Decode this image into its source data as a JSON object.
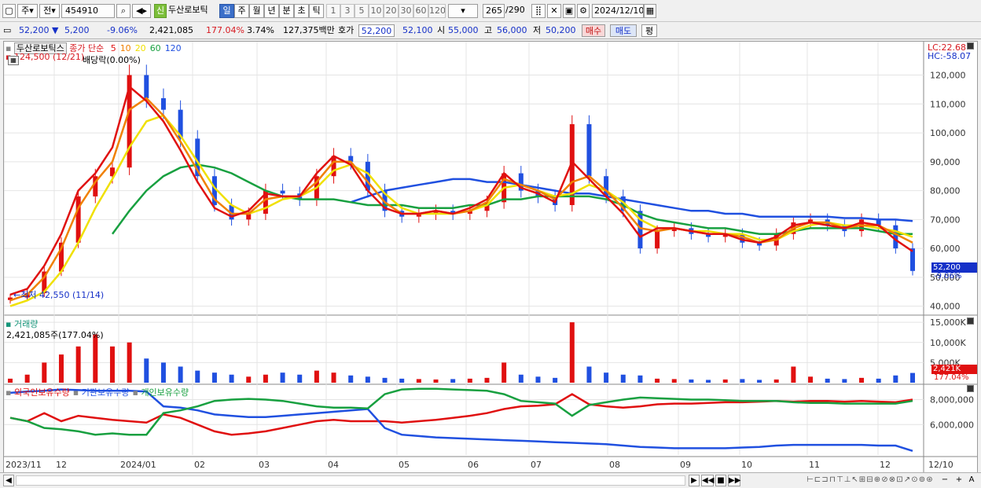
{
  "toolbar": {
    "market": "주",
    "type": "전",
    "code": "454910",
    "new_badge": "신",
    "stock_name": "두산로보틱",
    "periods": [
      "일",
      "주",
      "월",
      "년",
      "분",
      "초",
      "틱"
    ],
    "active_period": "일",
    "intervals": [
      "1",
      "3",
      "5",
      "10",
      "20",
      "30",
      "60",
      "120"
    ],
    "count": "265",
    "total": "/290",
    "date": "2024/12/10"
  },
  "info": {
    "price": "52,200",
    "change_arrow": "▼",
    "change": "5,200",
    "change_pct": "-9.06%",
    "volume": "2,421,085",
    "volume_ratio": "177.04%",
    "turnover": "3.74%",
    "amount": "127,375백만",
    "ask_label": "호가",
    "ask": "52,200",
    "bid": "52,100",
    "open_label": "시",
    "open": "55,000",
    "high_label": "고",
    "high": "56,000",
    "low_label": "저",
    "low": "50,200",
    "buy_btn": "매수",
    "sell_btn": "매도",
    "eval_btn": "평"
  },
  "chart": {
    "legend_name": "두산로보틱스",
    "legend_ma_prefix": "종가 단순",
    "ma_periods": [
      {
        "label": "5",
        "color": "#e01010"
      },
      {
        "label": "10",
        "color": "#f08000"
      },
      {
        "label": "20",
        "color": "#f0e000"
      },
      {
        "label": "60",
        "color": "#18a040"
      },
      {
        "label": "120",
        "color": "#2050e0"
      }
    ],
    "high_note": "124,500 (12/21)",
    "dividend_note": "배당락(0.00%)",
    "low_note": "최저 42,550 (11/14)",
    "lc": "LC:22.68",
    "hc": "HC:-58.07",
    "current_tag": "52,200",
    "current_pct": "-9.06%",
    "volume_title": "거래량",
    "volume_note": "2,421,085주(177.04%)",
    "volume_tag": "2,421K",
    "volume_pct": "177.04%",
    "holders_legend": [
      "외국인보유수량",
      "기관보유수량",
      "개인보유수량"
    ],
    "holders_colors": [
      "#e01010",
      "#2050e0",
      "#18a040"
    ],
    "x_labels": [
      "2023/11",
      "12",
      "2024/01",
      "02",
      "03",
      "04",
      "05",
      "06",
      "07",
      "08",
      "09",
      "10",
      "11",
      "12",
      "12/10"
    ]
  },
  "chart_data": [
    {
      "type": "line",
      "title": "",
      "series_note": "candlestick with moving averages",
      "ylim": [
        40000,
        124500
      ],
      "y_ticks": [
        40000,
        50000,
        60000,
        70000,
        80000,
        90000,
        100000,
        110000,
        120000
      ],
      "y_tick_labels": [
        "40,000",
        "50,000",
        "60,000",
        "70,000",
        "80,000",
        "90,000",
        "100,000",
        "110,000",
        "120,000"
      ],
      "x_months": [
        "2023/11",
        "12",
        "2024/01",
        "02",
        "03",
        "04",
        "05",
        "06",
        "07",
        "08",
        "09",
        "10",
        "11",
        "12"
      ],
      "close": [
        43000,
        44500,
        52000,
        62000,
        78000,
        85000,
        88000,
        120000,
        112000,
        108000,
        98000,
        85000,
        75000,
        70000,
        72000,
        80000,
        79000,
        77000,
        85000,
        92000,
        90000,
        80000,
        73000,
        71000,
        72000,
        73000,
        72000,
        73000,
        76000,
        86000,
        80000,
        78000,
        75000,
        103000,
        85000,
        78000,
        73000,
        60000,
        66000,
        67000,
        65000,
        64000,
        65000,
        62000,
        61000,
        65000,
        69000,
        70000,
        68000,
        66000,
        70000,
        68000,
        60000,
        52200
      ],
      "ma5": [
        44000,
        46000,
        54000,
        65000,
        80000,
        86000,
        95000,
        116000,
        111000,
        104000,
        94000,
        83000,
        74000,
        71000,
        73000,
        79000,
        78000,
        78000,
        86000,
        92000,
        89000,
        80000,
        74000,
        72000,
        72000,
        73000,
        72000,
        74000,
        77000,
        86000,
        81000,
        79000,
        76000,
        90000,
        84000,
        78000,
        72000,
        64000,
        67000,
        67000,
        66000,
        65000,
        65000,
        63000,
        62000,
        64000,
        68000,
        69000,
        68000,
        67000,
        69000,
        68000,
        63000,
        59000
      ],
      "ma10": [
        42000,
        44000,
        50000,
        60000,
        74000,
        83000,
        90000,
        108000,
        112000,
        106000,
        97000,
        87000,
        77000,
        72000,
        72000,
        77000,
        78000,
        78000,
        83000,
        90000,
        90000,
        83000,
        76000,
        72000,
        72000,
        73000,
        72000,
        73000,
        76000,
        84000,
        82000,
        80000,
        77000,
        83000,
        85000,
        80000,
        74000,
        67000,
        66000,
        67000,
        66000,
        65000,
        65000,
        64000,
        62000,
        63000,
        67000,
        69000,
        69000,
        67000,
        68000,
        68000,
        65000,
        62000
      ],
      "ma20": [
        40000,
        42000,
        45000,
        52000,
        62000,
        74000,
        84000,
        95000,
        104000,
        106000,
        99000,
        90000,
        81000,
        75000,
        72000,
        74000,
        77000,
        78000,
        81000,
        87000,
        89000,
        86000,
        79000,
        74000,
        72000,
        72000,
        72000,
        73000,
        75000,
        81000,
        82000,
        80000,
        78000,
        79000,
        82000,
        80000,
        76000,
        70000,
        67000,
        67000,
        66000,
        66000,
        65000,
        65000,
        63000,
        63000,
        66000,
        68000,
        69000,
        68000,
        68000,
        67000,
        66000,
        64000
      ],
      "ma60": [
        null,
        null,
        null,
        null,
        null,
        null,
        65000,
        73000,
        80000,
        85000,
        88000,
        89000,
        88000,
        86000,
        83000,
        80000,
        78000,
        77000,
        77000,
        77000,
        76000,
        75000,
        75000,
        75000,
        74000,
        74000,
        74000,
        75000,
        75000,
        77000,
        77000,
        78000,
        78000,
        78000,
        78000,
        77000,
        75000,
        72000,
        70000,
        69000,
        68000,
        67000,
        67000,
        66000,
        65000,
        65000,
        66000,
        67000,
        67000,
        67000,
        67000,
        66000,
        65000,
        65000
      ],
      "ma120": [
        null,
        null,
        null,
        null,
        null,
        null,
        null,
        null,
        null,
        null,
        null,
        null,
        null,
        null,
        null,
        null,
        null,
        null,
        null,
        null,
        76000,
        78000,
        80000,
        81000,
        82000,
        83000,
        84000,
        84000,
        83000,
        83000,
        82000,
        81000,
        80000,
        79000,
        79000,
        78000,
        77000,
        76000,
        75000,
        74000,
        73000,
        73000,
        72000,
        72000,
        71000,
        71000,
        71000,
        71000,
        71000,
        70500,
        70500,
        70000,
        70000,
        69500
      ]
    },
    {
      "type": "bar",
      "title": "거래량",
      "y_tick_labels": [
        "5,000K",
        "10,000K",
        "15,000K"
      ],
      "ylim": [
        0,
        16000000
      ],
      "values": [
        1000000,
        2000000,
        5000000,
        7000000,
        9000000,
        12000000,
        9000000,
        10000000,
        6000000,
        5000000,
        4000000,
        3000000,
        2500000,
        2000000,
        1500000,
        2000000,
        2500000,
        2000000,
        3000000,
        2500000,
        1800000,
        1500000,
        1200000,
        1000000,
        900000,
        800000,
        900000,
        1000000,
        1200000,
        5000000,
        2000000,
        1500000,
        1200000,
        15000000,
        4000000,
        2500000,
        2000000,
        1800000,
        1000000,
        900000,
        800000,
        700000,
        800000,
        900000,
        700000,
        800000,
        4000000,
        1500000,
        1000000,
        900000,
        1200000,
        1000000,
        1800000,
        2421085
      ]
    },
    {
      "type": "line",
      "title": "보유수량",
      "y_tick_labels": [
        "6,000,000",
        "8,000,000"
      ],
      "series": [
        {
          "name": "외국인보유수량",
          "values": [
            0.55,
            0.5,
            0.62,
            0.5,
            0.58,
            0.55,
            0.52,
            0.5,
            0.48,
            0.6,
            0.55,
            0.45,
            0.35,
            0.3,
            0.32,
            0.35,
            0.4,
            0.45,
            0.5,
            0.52,
            0.5,
            0.5,
            0.5,
            0.48,
            0.5,
            0.52,
            0.55,
            0.58,
            0.62,
            0.68,
            0.72,
            0.73,
            0.75,
            0.9,
            0.75,
            0.72,
            0.7,
            0.72,
            0.75,
            0.76,
            0.76,
            0.77,
            0.78,
            0.78,
            0.79,
            0.8,
            0.79,
            0.8,
            0.8,
            0.79,
            0.8,
            0.79,
            0.78,
            0.82
          ]
        },
        {
          "name": "기관보유수량",
          "values": [
            0.92,
            0.94,
            0.95,
            0.97,
            0.96,
            0.95,
            0.95,
            0.95,
            0.94,
            0.72,
            0.7,
            0.66,
            0.6,
            0.58,
            0.56,
            0.56,
            0.58,
            0.6,
            0.62,
            0.64,
            0.66,
            0.68,
            0.4,
            0.3,
            0.28,
            0.26,
            0.25,
            0.24,
            0.23,
            0.22,
            0.21,
            0.2,
            0.19,
            0.18,
            0.17,
            0.16,
            0.14,
            0.12,
            0.11,
            0.1,
            0.1,
            0.1,
            0.1,
            0.11,
            0.12,
            0.14,
            0.15,
            0.15,
            0.15,
            0.15,
            0.15,
            0.14,
            0.14,
            0.06
          ]
        },
        {
          "name": "개인보유수량",
          "values": [
            0.55,
            0.5,
            0.4,
            0.38,
            0.35,
            0.3,
            0.32,
            0.3,
            0.3,
            0.62,
            0.66,
            0.72,
            0.8,
            0.82,
            0.83,
            0.82,
            0.8,
            0.76,
            0.72,
            0.7,
            0.7,
            0.69,
            0.9,
            0.97,
            0.98,
            0.98,
            0.97,
            0.96,
            0.95,
            0.9,
            0.8,
            0.78,
            0.76,
            0.58,
            0.74,
            0.78,
            0.82,
            0.85,
            0.84,
            0.83,
            0.82,
            0.82,
            0.81,
            0.8,
            0.8,
            0.8,
            0.78,
            0.77,
            0.77,
            0.76,
            0.76,
            0.76,
            0.76,
            0.8
          ]
        }
      ]
    }
  ],
  "bottom": {
    "nav_next": "▶",
    "nav_prev2": "◀◀",
    "nav_stop": "■",
    "nav_next2": "▶▶",
    "zoom_minus": "−",
    "zoom_plus": "+",
    "font_btn": "A"
  }
}
